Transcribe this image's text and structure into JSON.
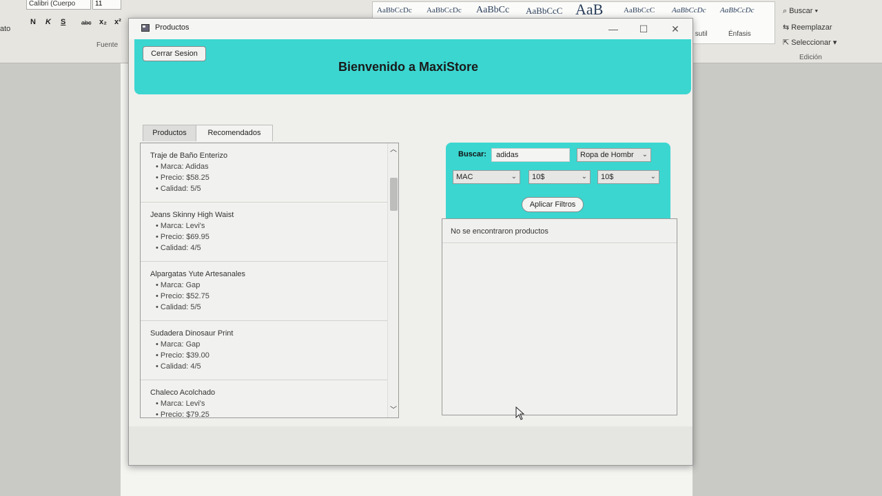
{
  "background": {
    "font_name": "Calibri (Cuerpo",
    "font_size": "11",
    "left_label": "ato",
    "group_font": "Fuente",
    "group_edit": "Edición",
    "format_buttons": [
      "N",
      "K",
      "S",
      "abc",
      "x₂",
      "x²"
    ],
    "style_samples": [
      "AaBbCcDc",
      "AaBbCcDc",
      "AaBbCc",
      "AaBbCcC",
      "AaB",
      "AaBbCcC",
      "AaBbCcDc",
      "AaBbCcDc"
    ],
    "style_labels": [
      "s sutil",
      "Énfasis"
    ],
    "edit_buscar": "Buscar",
    "edit_reemplazar": "Reemplazar",
    "edit_seleccionar": "Seleccionar"
  },
  "window": {
    "title": "Productos",
    "minimize": "—",
    "maximize": "☐",
    "close": "✕"
  },
  "header": {
    "logout_label": "Cerrar Sesion",
    "welcome": "Bienvenido a MaxiStore",
    "accent_color": "#3bd6d0"
  },
  "tabs": [
    {
      "label": "Productos",
      "active": true
    },
    {
      "label": "Recomendados",
      "active": false
    }
  ],
  "products": [
    {
      "name": "Traje de Baño Enterizo",
      "marca": "• Marca: Adidas",
      "precio": "• Precio: $58.25",
      "calidad": "• Calidad: 5/5"
    },
    {
      "name": "Jeans Skinny High Waist",
      "marca": "• Marca: Levi's",
      "precio": "• Precio: $69.95",
      "calidad": "• Calidad: 4/5"
    },
    {
      "name": "Alpargatas Yute Artesanales",
      "marca": "• Marca: Gap",
      "precio": "• Precio: $52.75",
      "calidad": "• Calidad: 5/5"
    },
    {
      "name": "Sudadera Dinosaur Print",
      "marca": "• Marca: Gap",
      "precio": "• Precio: $39.00",
      "calidad": "• Calidad: 4/5"
    },
    {
      "name": "Chaleco Acolchado",
      "marca": "• Marca: Levi's",
      "precio": "• Precio: $79.25",
      "calidad": ""
    }
  ],
  "filters": {
    "search_label": "Buscar:",
    "search_value": "adidas",
    "category": "Ropa de Hombr",
    "brand": "MAC",
    "price_min": "10$",
    "price_max": "10$",
    "apply_label": "Aplicar Filtros"
  },
  "results": {
    "message": "No se encontraron productos"
  }
}
